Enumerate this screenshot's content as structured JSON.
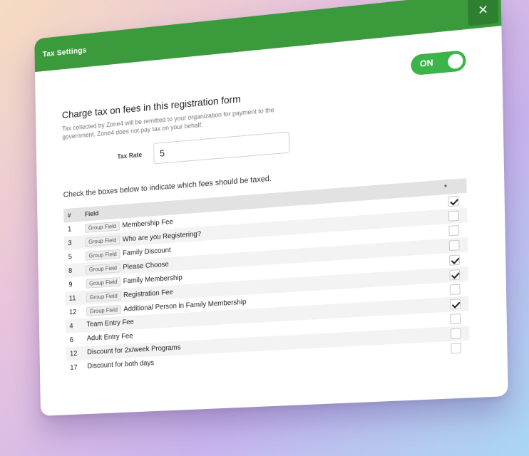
{
  "modal": {
    "title": "Tax Settings",
    "close_icon": "×"
  },
  "toggle": {
    "label": "ON",
    "state": "on"
  },
  "charge_tax": {
    "title": "Charge tax on fees in this registration form",
    "description": "Tax collected by Zone4 will be remitted to your organization for payment to the government. Zone4 does not pay tax on your behalf."
  },
  "tax_rate": {
    "label": "Tax Rate",
    "value": "5"
  },
  "instruction": "Check the boxes below to indicate which fees should be taxed.",
  "table": {
    "headers": {
      "num": "#",
      "field": "Field",
      "check": "*"
    },
    "rows": [
      {
        "num": "1",
        "badge": "Group Field",
        "name": "Membership Fee",
        "checked": true
      },
      {
        "num": "3",
        "badge": "Group Field",
        "name": "Who are you Registering?",
        "checked": false
      },
      {
        "num": "5",
        "badge": "Group Field",
        "name": "Family Discount",
        "checked": false
      },
      {
        "num": "8",
        "badge": "Group Field",
        "name": "Please Choose",
        "checked": false
      },
      {
        "num": "9",
        "badge": "Group Field",
        "name": "Family Membership",
        "checked": true
      },
      {
        "num": "11",
        "badge": "Group Field",
        "name": "Registration Fee",
        "checked": true
      },
      {
        "num": "12",
        "badge": "Group Field",
        "name": "Additional Person in Family Membership",
        "checked": false
      },
      {
        "num": "4",
        "badge": "",
        "name": "Team Entry Fee",
        "checked": true
      },
      {
        "num": "6",
        "badge": "",
        "name": "Adult Entry Fee",
        "checked": false
      },
      {
        "num": "12",
        "badge": "",
        "name": "Discount for 2x/week Programs",
        "checked": false
      },
      {
        "num": "17",
        "badge": "",
        "name": "Discount for both days",
        "checked": false
      }
    ]
  },
  "colors": {
    "header_green": "#3a9a3c",
    "toggle_green": "#3bb44a"
  }
}
